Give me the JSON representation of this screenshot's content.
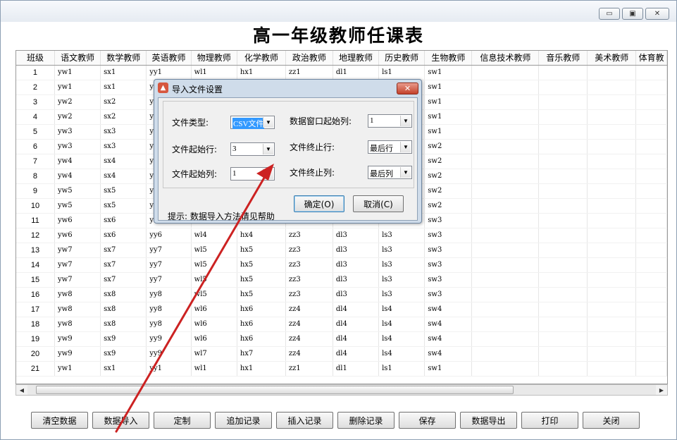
{
  "window": {
    "caption_buttons": {
      "minimize": "▭",
      "maximize": "▣",
      "close": "✕"
    }
  },
  "report_title": "高一年级教师任课表",
  "grid": {
    "columns": [
      "班级",
      "语文教师",
      "数学教师",
      "英语教师",
      "物理教师",
      "化学教师",
      "政治教师",
      "地理教师",
      "历史教师",
      "生物教师",
      "信息技术教师",
      "音乐教师",
      "美术教师",
      "体育教"
    ],
    "rows": [
      [
        "1",
        "yw1",
        "sx1",
        "yy1",
        "wl1",
        "hx1",
        "zz1",
        "dl1",
        "ls1",
        "sw1"
      ],
      [
        "2",
        "yw1",
        "sx1",
        "y",
        "",
        "",
        "",
        "",
        "",
        "sw1"
      ],
      [
        "3",
        "yw2",
        "sx2",
        "y",
        "",
        "",
        "",
        "",
        "",
        "sw1"
      ],
      [
        "4",
        "yw2",
        "sx2",
        "y",
        "",
        "",
        "",
        "",
        "",
        "sw1"
      ],
      [
        "5",
        "yw3",
        "sx3",
        "y",
        "",
        "",
        "",
        "",
        "",
        "sw1"
      ],
      [
        "6",
        "yw3",
        "sx3",
        "y",
        "",
        "",
        "",
        "",
        "",
        "sw2"
      ],
      [
        "7",
        "yw4",
        "sx4",
        "y",
        "",
        "",
        "",
        "",
        "",
        "sw2"
      ],
      [
        "8",
        "yw4",
        "sx4",
        "y",
        "",
        "",
        "",
        "",
        "",
        "sw2"
      ],
      [
        "9",
        "yw5",
        "sx5",
        "y",
        "",
        "",
        "",
        "",
        "",
        "sw2"
      ],
      [
        "10",
        "yw5",
        "sx5",
        "y",
        "",
        "",
        "",
        "",
        "",
        "sw2"
      ],
      [
        "11",
        "yw6",
        "sx6",
        "y",
        "",
        "",
        "",
        "",
        "",
        "sw3"
      ],
      [
        "12",
        "yw6",
        "sx6",
        "yy6",
        "wl4",
        "hx4",
        "zz3",
        "dl3",
        "ls3",
        "sw3"
      ],
      [
        "13",
        "yw7",
        "sx7",
        "yy7",
        "wl5",
        "hx5",
        "zz3",
        "dl3",
        "ls3",
        "sw3"
      ],
      [
        "14",
        "yw7",
        "sx7",
        "yy7",
        "wl5",
        "hx5",
        "zz3",
        "dl3",
        "ls3",
        "sw3"
      ],
      [
        "15",
        "yw7",
        "sx7",
        "yy7",
        "wl5",
        "hx5",
        "zz3",
        "dl3",
        "ls3",
        "sw3"
      ],
      [
        "16",
        "yw8",
        "sx8",
        "yy8",
        "wl5",
        "hx5",
        "zz3",
        "dl3",
        "ls3",
        "sw3"
      ],
      [
        "17",
        "yw8",
        "sx8",
        "yy8",
        "wl6",
        "hx6",
        "zz4",
        "dl4",
        "ls4",
        "sw4"
      ],
      [
        "18",
        "yw8",
        "sx8",
        "yy8",
        "wl6",
        "hx6",
        "zz4",
        "dl4",
        "ls4",
        "sw4"
      ],
      [
        "19",
        "yw9",
        "sx9",
        "yy9",
        "wl6",
        "hx6",
        "zz4",
        "dl4",
        "ls4",
        "sw4"
      ],
      [
        "20",
        "yw9",
        "sx9",
        "yy9",
        "wl7",
        "hx7",
        "zz4",
        "dl4",
        "ls4",
        "sw4"
      ],
      [
        "21",
        "yw1",
        "sx1",
        "yy1",
        "wl1",
        "hx1",
        "zz1",
        "dl1",
        "ls1",
        "sw1"
      ]
    ]
  },
  "scrollbar": {
    "left_arrow": "◀",
    "right_arrow": "▶"
  },
  "bottom_buttons": [
    "清空数据",
    "数据导入",
    "定制",
    "追加记录",
    "插入记录",
    "删除记录",
    "保存",
    "数据导出",
    "打印",
    "关闭"
  ],
  "dialog": {
    "title": "导入文件设置",
    "close": "✕",
    "file_type_label": "文件类型:",
    "file_type_value": "CSV文件",
    "start_row_label": "文件起始行:",
    "start_row_value": "3",
    "start_col_label": "文件起始列:",
    "start_col_value": "1",
    "win_start_col_label": "数据窗口起始列:",
    "win_start_col_value": "1",
    "end_row_label": "文件终止行:",
    "end_row_value": "最后行",
    "end_col_label": "文件终止列:",
    "end_col_value": "最后列",
    "dropdown_arrow": "▼",
    "hint": "提示: 数据导入方法请见帮助",
    "ok_label": "确定(O)",
    "cancel_label": "取消(C)"
  },
  "colors": {
    "annotation_arrow": "#cc2222"
  }
}
